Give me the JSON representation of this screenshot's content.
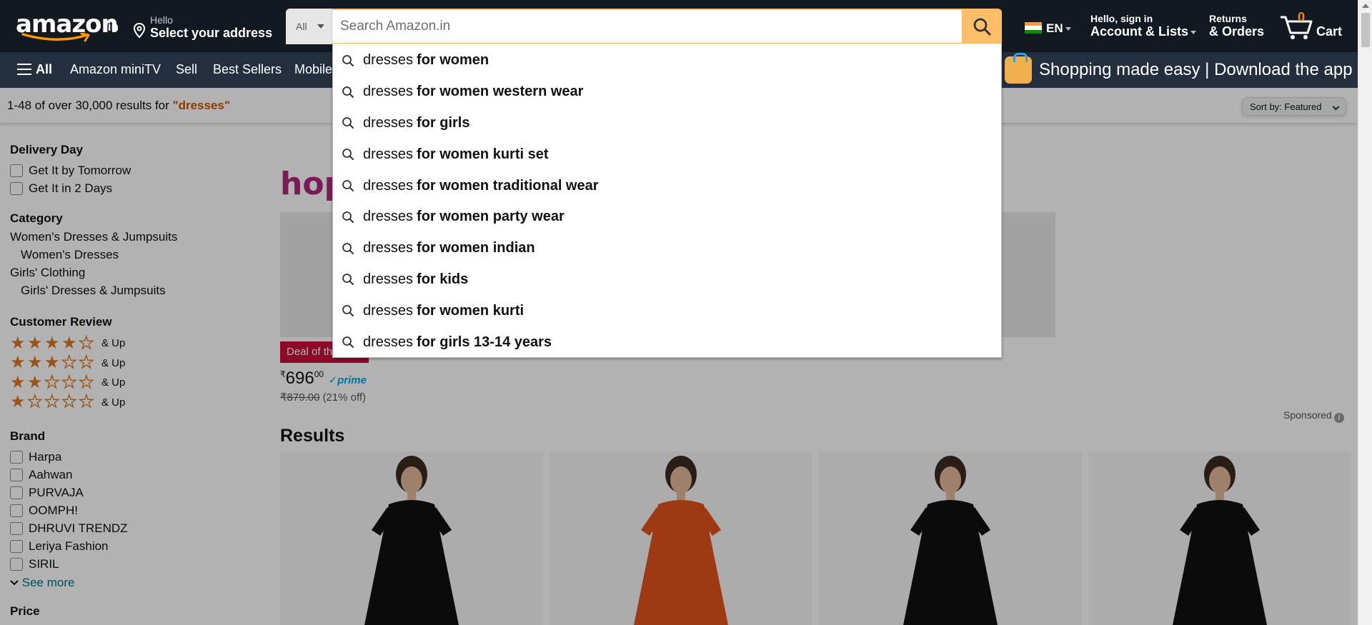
{
  "nav": {
    "logo_word": "amazon",
    "logo_tld": ".in",
    "address_line1": "Hello",
    "address_line2": "Select your address",
    "search_category": "All",
    "search_placeholder": "Search Amazon.in",
    "language": "EN",
    "account_line1": "Hello, sign in",
    "account_line2": "Account & Lists",
    "returns_line1": "Returns",
    "returns_line2": "& Orders",
    "cart_count": "0",
    "cart_label": "Cart"
  },
  "subnav": {
    "all_label": "All",
    "items": [
      "Amazon miniTV",
      "Sell",
      "Best Sellers",
      "Mobile"
    ],
    "promo_text": "Shopping made easy | Download the app"
  },
  "results_bar": {
    "count_text": "1-48 of over 30,000 results for ",
    "query": "\"dresses\"",
    "sort_label": "Sort by:",
    "sort_value": "Featured"
  },
  "sidebar": {
    "delivery_heading": "Delivery Day",
    "delivery_options": [
      "Get It by Tomorrow",
      "Get It in 2 Days"
    ],
    "category_heading": "Category",
    "categories": [
      "Women's Dresses & Jumpsuits",
      "Women's Dresses",
      "Girls' Clothing",
      "Girls' Dresses & Jumpsuits"
    ],
    "review_heading": "Customer Review",
    "review_ratings": [
      4,
      3,
      2,
      1
    ],
    "review_suffix": "& Up",
    "brand_heading": "Brand",
    "brands": [
      "Harpa",
      "Aahwan",
      "PURVAJA",
      "OOMPH!",
      "DHRUVI TRENDZ",
      "Leriya Fashion",
      "SIRIL"
    ],
    "see_more": "See more",
    "price_heading": "Price"
  },
  "banner": {
    "brand_text": "hops",
    "deal_badge": "Deal of the Day",
    "price_symbol": "₹",
    "price_whole": "696",
    "price_fraction": "00",
    "prime_label": "prime",
    "mrp": "₹879.00",
    "discount": "(21% off)",
    "sponsored": "Sponsored"
  },
  "results_heading": "Results",
  "product_dress_colors": [
    "#111111",
    "#e2531c",
    "#111111",
    "#111111"
  ],
  "suggestions": [
    {
      "typed": "dresses",
      "completion": "for women"
    },
    {
      "typed": "dresses",
      "completion": "for women western wear"
    },
    {
      "typed": "dresses",
      "completion": "for girls"
    },
    {
      "typed": "dresses",
      "completion": "for women kurti set"
    },
    {
      "typed": "dresses",
      "completion": "for women traditional wear"
    },
    {
      "typed": "dresses",
      "completion": "for women party wear"
    },
    {
      "typed": "dresses",
      "completion": "for women indian"
    },
    {
      "typed": "dresses",
      "completion": "for kids"
    },
    {
      "typed": "dresses",
      "completion": "for women kurti"
    },
    {
      "typed": "dresses",
      "completion": "for girls 13-14 years"
    }
  ],
  "colors": {
    "nav_bg": "#131921",
    "subnav_bg": "#232f3e",
    "search_button": "#febd69",
    "accent_orange": "#c45500",
    "star": "#de7921",
    "deal_red": "#cc0c39",
    "link_teal": "#007185"
  }
}
